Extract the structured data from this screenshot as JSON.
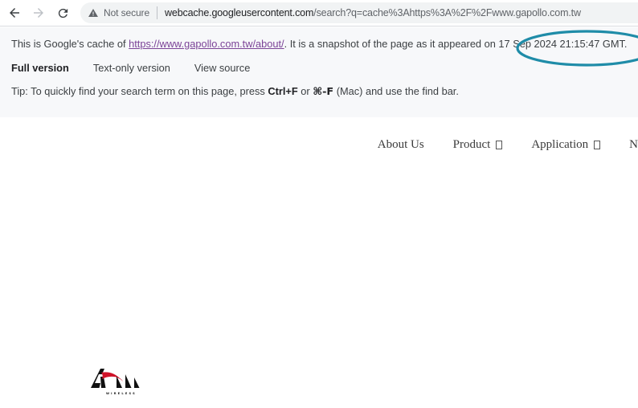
{
  "browser": {
    "back_icon": "back-arrow-icon",
    "forward_icon": "forward-arrow-icon",
    "reload_icon": "reload-icon",
    "security_icon": "warning-triangle-icon",
    "security_label": "Not secure",
    "url_host": "webcache.googleusercontent.com",
    "url_path": "/search?q=cache%3Ahttps%3A%2F%2Fwww.gapollo.com.tw",
    "url_full": "webcache.googleusercontent.com/search?q=cache%3Ahttps%3A%2F%2Fwww.gapollo.com.tw"
  },
  "cache_banner": {
    "intro_before_link": "This is Google's cache of ",
    "cached_url": "https://www.gapollo.com.tw/about/",
    "intro_after_link": ". It is a snapshot of the page as it appeared on ",
    "snapshot_date": "17 Sep 2024 21:15:47 GMT.",
    "links": [
      {
        "label": "Full version",
        "bold": true
      },
      {
        "label": "Text-only version",
        "bold": false
      },
      {
        "label": "View source",
        "bold": false
      }
    ],
    "tip_part_1": "Tip: To quickly find your search term on this page, press ",
    "tip_shortcut_1": "Ctrl+F",
    "tip_part_2": " or ",
    "tip_shortcut_2": "⌘-F",
    "tip_part_3": " (Mac) and use the find bar."
  },
  "site": {
    "nav_items": [
      {
        "label": "About Us",
        "has_caret": false
      },
      {
        "label": "Product",
        "has_caret": true
      },
      {
        "label": "Application",
        "has_caret": true
      },
      {
        "label": "N",
        "has_caret": false
      }
    ],
    "logo_name": "apollo-wireless-logo",
    "logo_wordmark": "WIRELESS"
  },
  "annotation": {
    "name": "highlight-ellipse",
    "color": "#1f8ca8",
    "target": "snapshot date"
  },
  "colors": {
    "banner_bg": "#f7f8fa",
    "omnibox_bg": "#f1f3f4",
    "link_purple": "#7b4397",
    "annotation_teal": "#1f8ca8",
    "logo_red": "#cf1229",
    "logo_black": "#111111"
  }
}
